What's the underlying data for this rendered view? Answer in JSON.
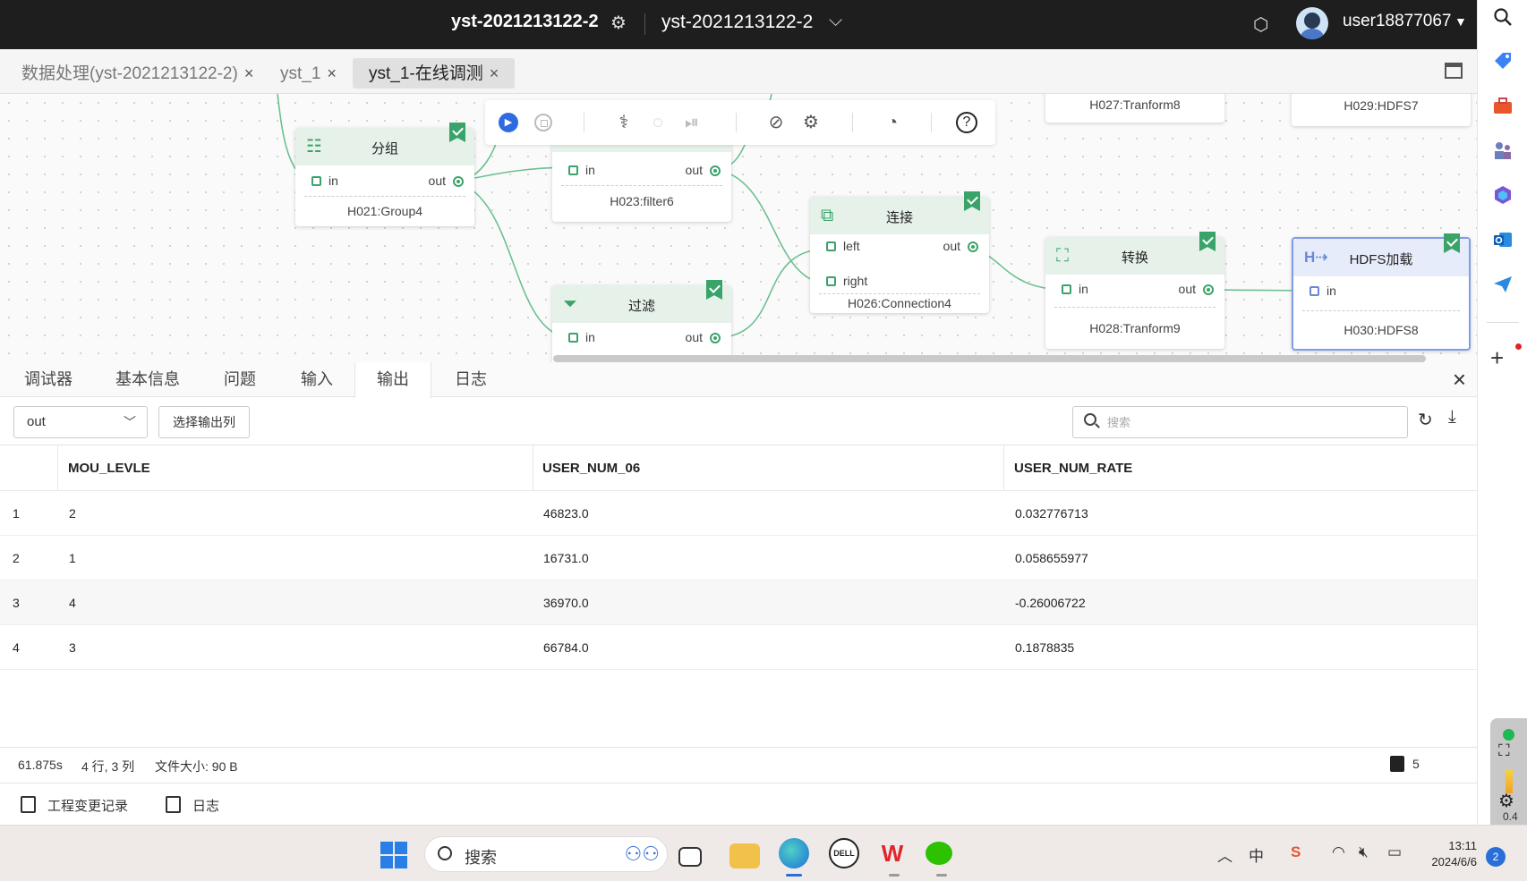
{
  "topbar": {
    "project_name": "yst-2021213122-2",
    "workspace": "yst-2021213122-2",
    "username": "user18877067"
  },
  "tabs": [
    {
      "label": "数据处理(yst-2021213122-2)",
      "active": false
    },
    {
      "label": "yst_1",
      "active": false
    },
    {
      "label": "yst_1-在线调测",
      "active": true
    }
  ],
  "canvas": {
    "nodes": {
      "group4": {
        "title": "分组",
        "id": "H021:Group4",
        "in": "in",
        "out": "out"
      },
      "filter6": {
        "id": "H023:filter6",
        "in": "in",
        "out": "out"
      },
      "filter": {
        "title": "过滤",
        "in": "in",
        "out": "out"
      },
      "conn4": {
        "title": "连接",
        "id": "H026:Connection4",
        "left": "left",
        "right": "right",
        "out": "out"
      },
      "tf8": {
        "id": "H027:Tranform8"
      },
      "tf9": {
        "title": "转换",
        "id": "H028:Tranform9",
        "in": "in",
        "out": "out"
      },
      "hdfs7": {
        "id": "H029:HDFS7"
      },
      "hdfs8": {
        "title": "HDFS加载",
        "id": "H030:HDFS8",
        "in": "in"
      }
    }
  },
  "panel": {
    "tabs": [
      "调试器",
      "基本信息",
      "问题",
      "输入",
      "输出",
      "日志"
    ],
    "active_tab": "输出",
    "output_select": "out",
    "select_columns_label": "选择输出列",
    "search_placeholder": "搜索",
    "table": {
      "columns": [
        "MOU_LEVLE",
        "USER_NUM_06",
        "USER_NUM_RATE"
      ],
      "rows": [
        {
          "idx": "1",
          "cells": [
            "2",
            "46823.0",
            "0.032776713"
          ]
        },
        {
          "idx": "2",
          "cells": [
            "1",
            "16731.0",
            "0.058655977"
          ]
        },
        {
          "idx": "3",
          "cells": [
            "4",
            "36970.0",
            "-0.26006722"
          ]
        },
        {
          "idx": "4",
          "cells": [
            "3",
            "66784.0",
            "0.1878835"
          ]
        }
      ]
    },
    "status": {
      "time": "61.875s",
      "dims": "4 行, 3 列",
      "size": "文件大小: 90 B",
      "count": "5"
    }
  },
  "footer": {
    "changes": "工程变更记录",
    "log": "日志"
  },
  "widget": {
    "value": "0.4"
  },
  "taskbar": {
    "search": "搜索",
    "ime": "中",
    "time": "13:11",
    "date": "2024/6/6",
    "notifications": "2"
  }
}
